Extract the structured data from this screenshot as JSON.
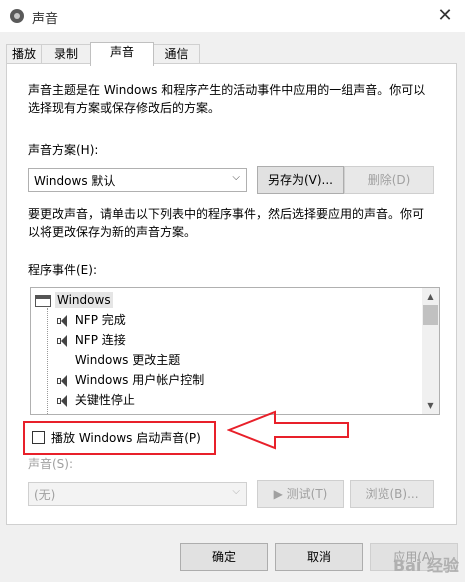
{
  "window": {
    "title": "声音",
    "close_glyph": "✕",
    "title_icon": "speaker-icon"
  },
  "tabs": [
    {
      "label": "播放"
    },
    {
      "label": "录制"
    },
    {
      "label": "声音"
    },
    {
      "label": "通信"
    }
  ],
  "active_tab": "声音",
  "intro_text_line1": "声音主题是在 Windows 和程序产生的活动事件中应用的一组声音。你可以",
  "intro_text_line2": "选择现有方案或保存修改后的方案。",
  "scheme": {
    "label": "声音方案(H):",
    "selected": "Windows 默认",
    "save_as_label": "另存为(V)...",
    "delete_label": "删除(D)"
  },
  "change_text_line1": "要更改声音，请单击以下列表中的程序事件，然后选择要应用的声音。你可",
  "change_text_line2": "以将更改保存为新的声音方案。",
  "events": {
    "label": "程序事件(E):",
    "root": "Windows",
    "items": [
      {
        "label": "NFP 完成",
        "has_sound": true
      },
      {
        "label": "NFP 连接",
        "has_sound": true
      },
      {
        "label": "Windows 更改主题",
        "has_sound": false
      },
      {
        "label": "Windows 用户帐户控制",
        "has_sound": true
      },
      {
        "label": "关键性停止",
        "has_sound": true
      }
    ]
  },
  "startup_sound": {
    "label": "播放 Windows 启动声音(P)",
    "checked": false
  },
  "sound": {
    "label": "声音(S):",
    "selected": "(无)",
    "test_label": "▶ 测试(T)",
    "browse_label": "浏览(B)..."
  },
  "footer": {
    "ok": "确定",
    "cancel": "取消",
    "apply": "应用(A)"
  },
  "watermark_text": "Bai 经验",
  "colors": {
    "annotation_red": "#e8202a",
    "window_bg": "#f0f0f0"
  }
}
